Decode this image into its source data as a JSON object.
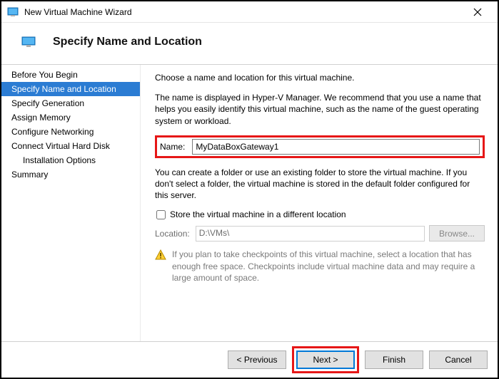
{
  "titlebar": {
    "title": "New Virtual Machine Wizard"
  },
  "header": {
    "title": "Specify Name and Location"
  },
  "sidebar": {
    "items": [
      {
        "label": "Before You Begin",
        "selected": false,
        "indent": false
      },
      {
        "label": "Specify Name and Location",
        "selected": true,
        "indent": false
      },
      {
        "label": "Specify Generation",
        "selected": false,
        "indent": false
      },
      {
        "label": "Assign Memory",
        "selected": false,
        "indent": false
      },
      {
        "label": "Configure Networking",
        "selected": false,
        "indent": false
      },
      {
        "label": "Connect Virtual Hard Disk",
        "selected": false,
        "indent": false
      },
      {
        "label": "Installation Options",
        "selected": false,
        "indent": true
      },
      {
        "label": "Summary",
        "selected": false,
        "indent": false
      }
    ]
  },
  "content": {
    "intro": "Choose a name and location for this virtual machine.",
    "desc": "The name is displayed in Hyper-V Manager. We recommend that you use a name that helps you easily identify this virtual machine, such as the name of the guest operating system or workload.",
    "name_label": "Name:",
    "name_value": "MyDataBoxGateway1",
    "folder_desc": "You can create a folder or use an existing folder to store the virtual machine. If you don't select a folder, the virtual machine is stored in the default folder configured for this server.",
    "store_label": "Store the virtual machine in a different location",
    "location_label": "Location:",
    "location_value": "D:\\VMs\\",
    "browse_label": "Browse...",
    "warning": "If you plan to take checkpoints of this virtual machine, select a location that has enough free space. Checkpoints include virtual machine data and may require a large amount of space."
  },
  "footer": {
    "previous": "< Previous",
    "next": "Next >",
    "finish": "Finish",
    "cancel": "Cancel"
  }
}
